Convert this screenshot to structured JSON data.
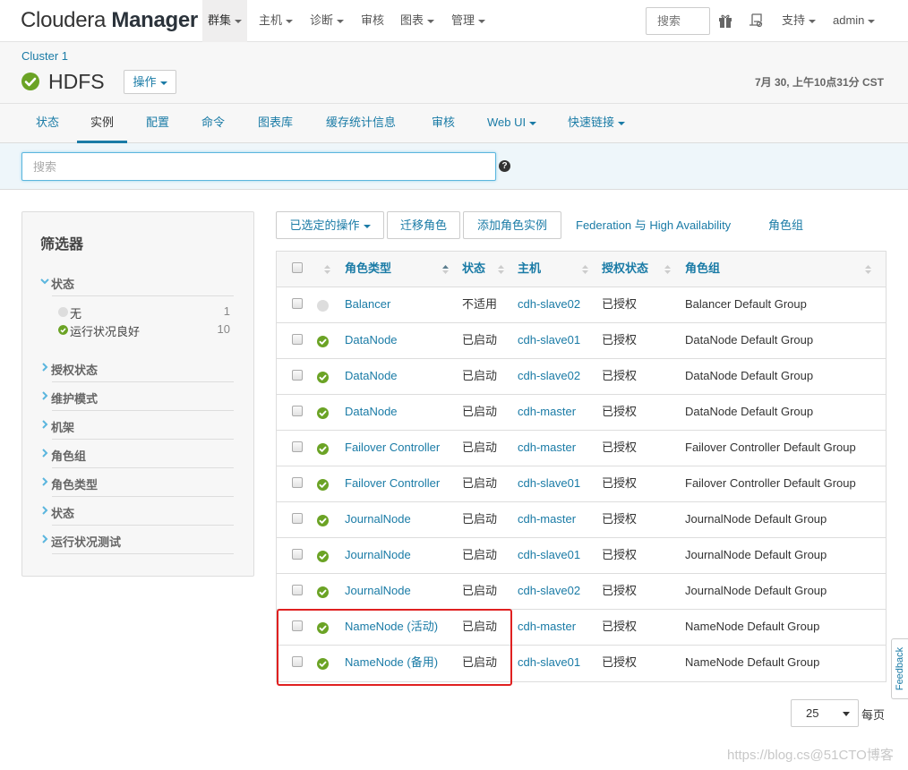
{
  "topbar": {
    "brand_light": "Cloudera ",
    "brand_bold": "Manager",
    "nav": [
      {
        "label": "群集",
        "dropdown": true,
        "active": true
      },
      {
        "label": "主机",
        "dropdown": true
      },
      {
        "label": "诊断",
        "dropdown": true
      },
      {
        "label": "审核",
        "dropdown": false
      },
      {
        "label": "图表",
        "dropdown": true
      },
      {
        "label": "管理",
        "dropdown": true
      }
    ],
    "search_placeholder": "搜索",
    "icons": [
      "gift-icon",
      "scroll-icon"
    ],
    "support_label": "支持",
    "user_label": "admin"
  },
  "header": {
    "cluster": "Cluster 1",
    "service": "HDFS",
    "service_status": "good-health",
    "actions_label": "操作",
    "timestamp": "7月 30, 上午10点31分 CST"
  },
  "tabs": [
    {
      "label": "状态"
    },
    {
      "label": "实例",
      "active": true
    },
    {
      "label": "配置"
    },
    {
      "label": "命令"
    },
    {
      "label": "图表库"
    },
    {
      "label": "缓存统计信息"
    },
    {
      "label": "审核"
    },
    {
      "label": "Web UI",
      "dropdown": true
    },
    {
      "label": "快速链接",
      "dropdown": true
    }
  ],
  "search": {
    "placeholder": "搜索",
    "value": "",
    "help": "?"
  },
  "filter": {
    "title": "筛选器",
    "sections": [
      {
        "label": "状态",
        "expanded": true,
        "options": [
          {
            "label": "无",
            "count": "1",
            "color": "#dddddd"
          },
          {
            "label": "运行状况良好",
            "count": "10",
            "color": "#6ba325"
          }
        ]
      },
      {
        "label": "授权状态",
        "expanded": false
      },
      {
        "label": "维护模式",
        "expanded": false
      },
      {
        "label": "机架",
        "expanded": false
      },
      {
        "label": "角色组",
        "expanded": false
      },
      {
        "label": "角色类型",
        "expanded": false
      },
      {
        "label": "状态",
        "expanded": false
      },
      {
        "label": "运行状况测试",
        "expanded": false
      }
    ]
  },
  "toolbar": {
    "selected_actions": "已选定的操作",
    "migrate_roles": "迁移角色",
    "add_role_instances": "添加角色实例",
    "federation_ha": "Federation 与 High Availability",
    "role_groups": "角色组"
  },
  "table": {
    "columns": [
      "角色类型",
      "状态",
      "主机",
      "授权状态",
      "角色组"
    ],
    "rows": [
      {
        "health": "none",
        "role": "Balancer",
        "state": "不适用",
        "host": "cdh-slave02",
        "auth": "已授权",
        "group": "Balancer Default Group"
      },
      {
        "health": "good",
        "role": "DataNode",
        "state": "已启动",
        "host": "cdh-slave01",
        "auth": "已授权",
        "group": "DataNode Default Group"
      },
      {
        "health": "good",
        "role": "DataNode",
        "state": "已启动",
        "host": "cdh-slave02",
        "auth": "已授权",
        "group": "DataNode Default Group"
      },
      {
        "health": "good",
        "role": "DataNode",
        "state": "已启动",
        "host": "cdh-master",
        "auth": "已授权",
        "group": "DataNode Default Group"
      },
      {
        "health": "good",
        "role": "Failover Controller",
        "state": "已启动",
        "host": "cdh-master",
        "auth": "已授权",
        "group": "Failover Controller Default Group"
      },
      {
        "health": "good",
        "role": "Failover Controller",
        "state": "已启动",
        "host": "cdh-slave01",
        "auth": "已授权",
        "group": "Failover Controller Default Group"
      },
      {
        "health": "good",
        "role": "JournalNode",
        "state": "已启动",
        "host": "cdh-master",
        "auth": "已授权",
        "group": "JournalNode Default Group"
      },
      {
        "health": "good",
        "role": "JournalNode",
        "state": "已启动",
        "host": "cdh-slave01",
        "auth": "已授权",
        "group": "JournalNode Default Group"
      },
      {
        "health": "good",
        "role": "JournalNode",
        "state": "已启动",
        "host": "cdh-slave02",
        "auth": "已授权",
        "group": "JournalNode Default Group"
      },
      {
        "health": "good",
        "role": "NameNode (活动)",
        "state": "已启动",
        "host": "cdh-master",
        "auth": "已授权",
        "group": "NameNode Default Group"
      },
      {
        "health": "good",
        "role": "NameNode (备用)",
        "state": "已启动",
        "host": "cdh-slave01",
        "auth": "已授权",
        "group": "NameNode Default Group"
      }
    ]
  },
  "pagination": {
    "per_page_value": "25",
    "per_page_label": "每页"
  },
  "feedback_label": "Feedback",
  "watermark": "https://blog.cs@51CTO博客",
  "colors": {
    "accent": "#1a7ba6",
    "good": "#6ba325",
    "highlight": "#e02020"
  }
}
